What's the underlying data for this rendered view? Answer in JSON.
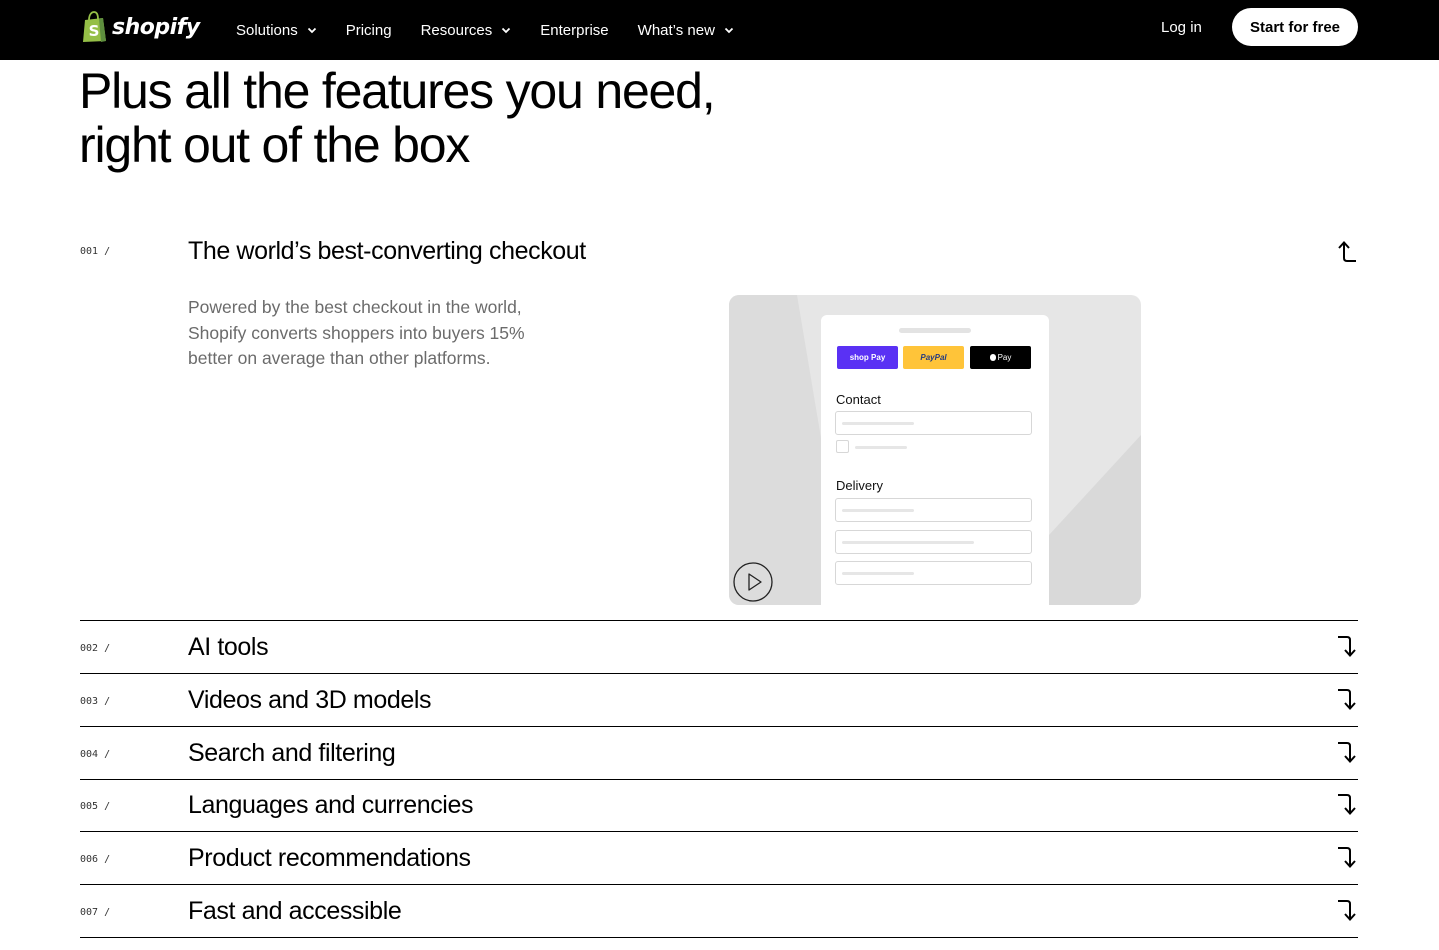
{
  "nav": {
    "logo_text": "shopify",
    "links": [
      {
        "label": "Solutions",
        "has_dropdown": true
      },
      {
        "label": "Pricing",
        "has_dropdown": false
      },
      {
        "label": "Resources",
        "has_dropdown": true
      },
      {
        "label": "Enterprise",
        "has_dropdown": false
      },
      {
        "label": "What’s new",
        "has_dropdown": true
      }
    ],
    "login_label": "Log in",
    "cta_label": "Start for free"
  },
  "headline": {
    "line1": "Plus all the features you need,",
    "line2": "right out of the box"
  },
  "features": [
    {
      "number": "001 /",
      "title": "The world’s best-converting checkout",
      "expanded": true,
      "description": "Powered by the best checkout in the world, Shopify converts shoppers into buyers 15% better on average than other platforms.",
      "icon": "arrow-up-icon"
    },
    {
      "number": "002 /",
      "title": "AI tools",
      "expanded": false,
      "icon": "arrow-down-icon"
    },
    {
      "number": "003 /",
      "title": "Videos and 3D models",
      "expanded": false,
      "icon": "arrow-down-icon"
    },
    {
      "number": "004 /",
      "title": "Search and filtering",
      "expanded": false,
      "icon": "arrow-down-icon"
    },
    {
      "number": "005 /",
      "title": "Languages and currencies",
      "expanded": false,
      "icon": "arrow-down-icon"
    },
    {
      "number": "006 /",
      "title": "Product recommendations",
      "expanded": false,
      "icon": "arrow-down-icon"
    },
    {
      "number": "007 /",
      "title": "Fast and accessible",
      "expanded": false,
      "icon": "arrow-down-icon"
    }
  ],
  "checkout_mockup": {
    "pay_buttons": [
      "shop Pay",
      "PayPal",
      "Pay"
    ],
    "contact_label": "Contact",
    "delivery_label": "Delivery"
  },
  "colors": {
    "nav_bg": "#000000",
    "shop_pay": "#5a31f4",
    "paypal": "#ffc439",
    "logo_green": "#95bf47"
  }
}
